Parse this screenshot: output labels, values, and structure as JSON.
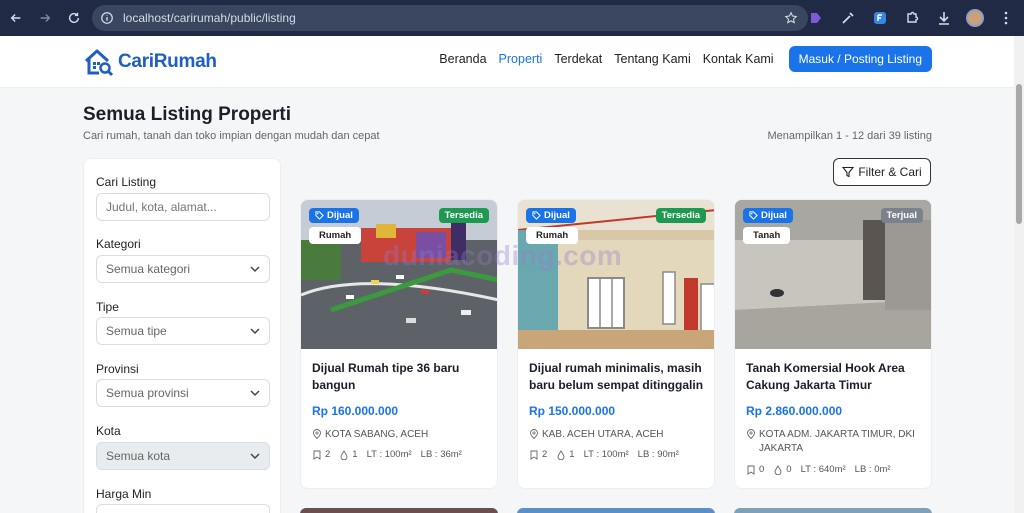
{
  "browser": {
    "url": "localhost/carirumah/public/listing"
  },
  "header": {
    "logo_text": "CariRumah",
    "nav": [
      "Beranda",
      "Properti",
      "Terdekat",
      "Tentang Kami",
      "Kontak Kami"
    ],
    "active_nav": "Properti",
    "cta_label": "Masuk / Posting Listing"
  },
  "page": {
    "title": "Semua Listing Properti",
    "subtitle": "Cari rumah, tanah dan toko impian dengan mudah dan cepat",
    "result_count": "Menampilkan 1 - 12 dari 39 listing",
    "filter_button": "Filter & Cari"
  },
  "sidebar": {
    "search_label": "Cari Listing",
    "search_placeholder": "Judul, kota, alamat...",
    "category_label": "Kategori",
    "category_value": "Semua kategori",
    "type_label": "Tipe",
    "type_value": "Semua tipe",
    "province_label": "Provinsi",
    "province_value": "Semua provinsi",
    "city_label": "Kota",
    "city_value": "Semua kota",
    "price_min_label": "Harga Min"
  },
  "listings": [
    {
      "type": "Dijual",
      "category": "Rumah",
      "status": "Tersedia",
      "title": "Dijual Rumah tipe 36 baru bangun",
      "price": "Rp 160.000.000",
      "location": "KOTA SABANG, ACEH",
      "beds": "2",
      "baths": "1",
      "lt": "LT : 100m²",
      "lb": "LB : 36m²"
    },
    {
      "type": "Dijual",
      "category": "Rumah",
      "status": "Tersedia",
      "title": "Dijual rumah minimalis, masih baru belum sempat ditinggalin",
      "price": "Rp 150.000.000",
      "location": "KAB. ACEH UTARA, ACEH",
      "beds": "2",
      "baths": "1",
      "lt": "LT : 100m²",
      "lb": "LB : 90m²"
    },
    {
      "type": "Dijual",
      "category": "Tanah",
      "status": "Terjual",
      "title": "Tanah Komersial Hook Area Cakung Jakarta Timur",
      "price": "Rp 2.860.000.000",
      "location": "KOTA ADM. JAKARTA TIMUR, DKI JAKARTA",
      "beds": "0",
      "baths": "0",
      "lt": "LT : 640m²",
      "lb": "LB : 0m²"
    }
  ],
  "watermark": "duniacoding.com",
  "colors": {
    "brand": "#1a73e8",
    "available": "#1e9a50",
    "sold": "#7a828c"
  }
}
